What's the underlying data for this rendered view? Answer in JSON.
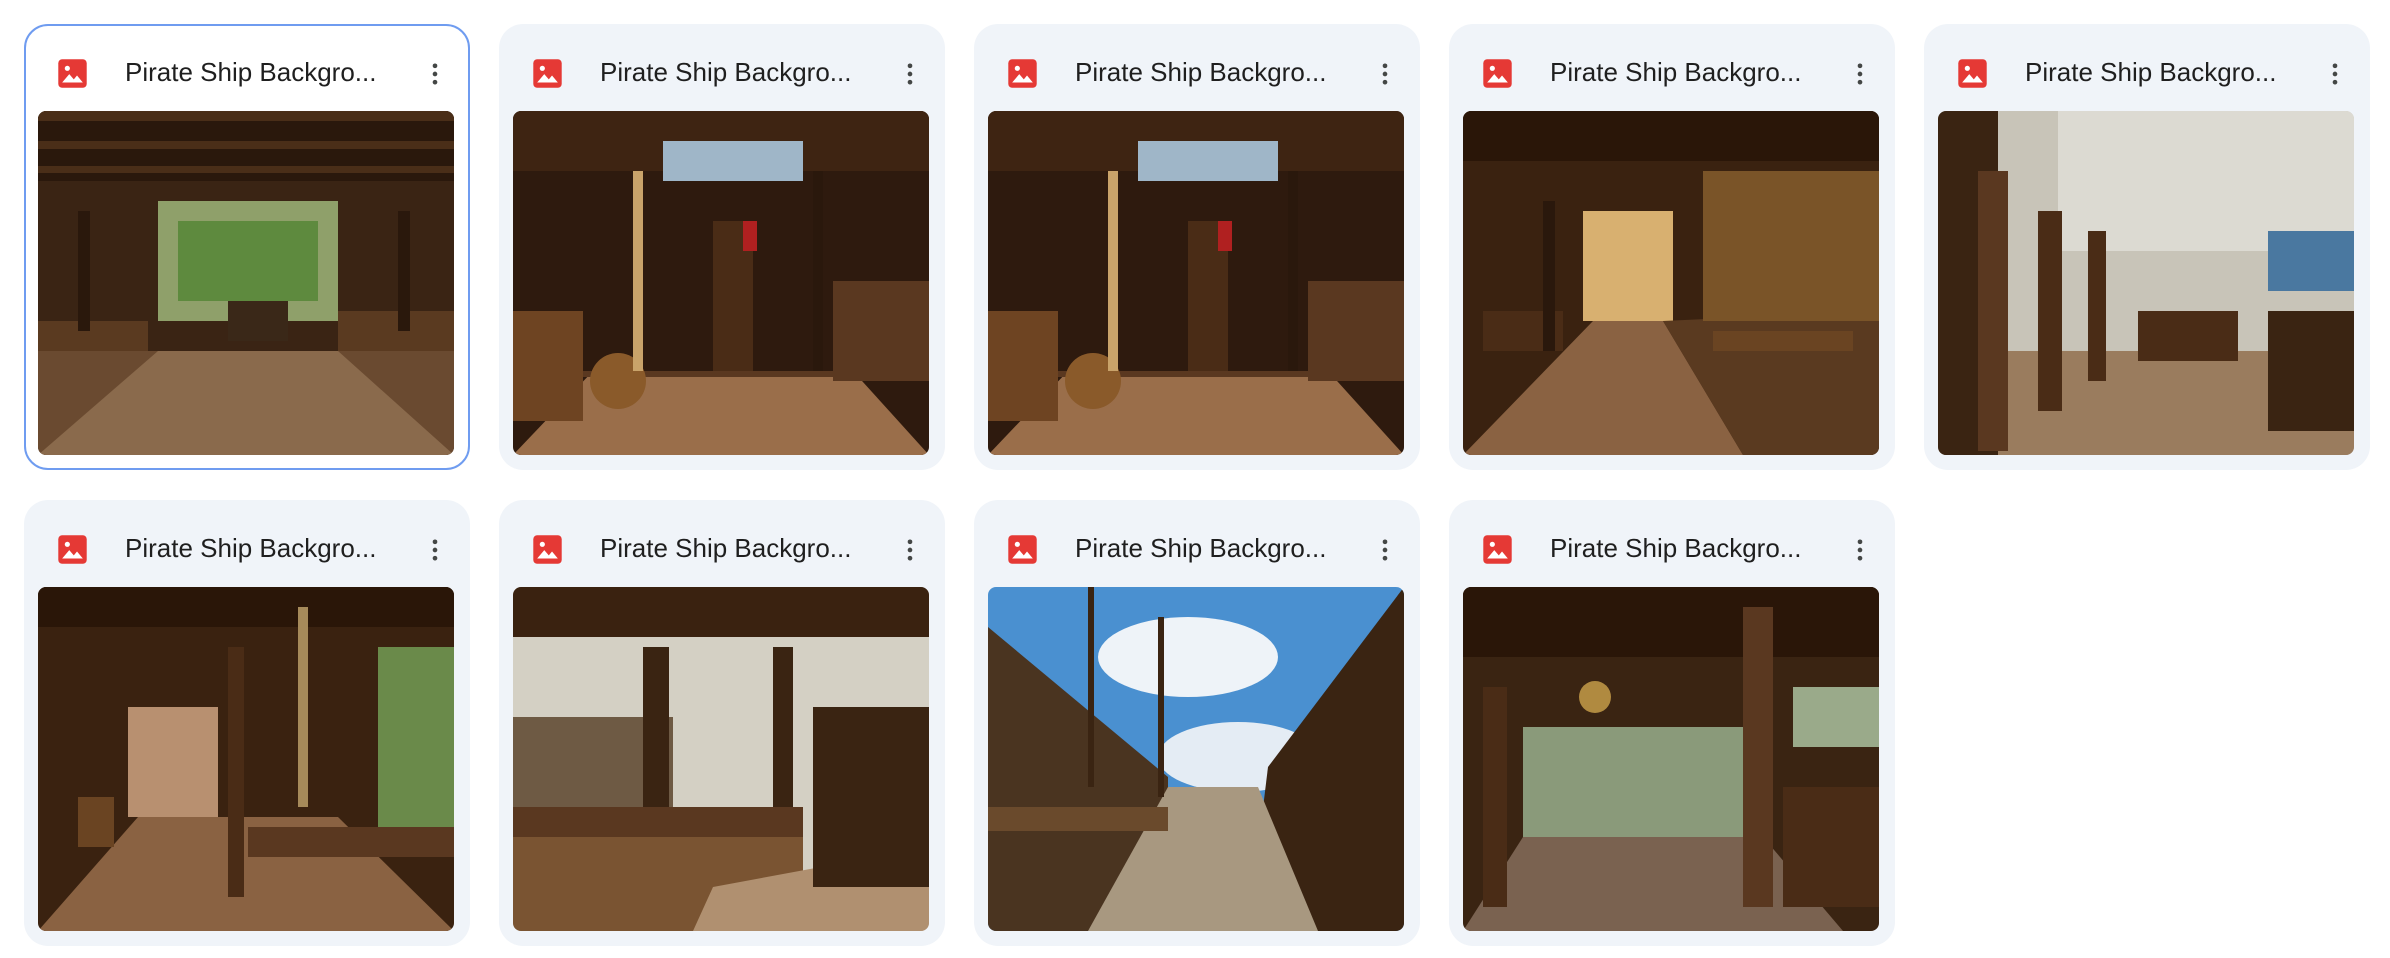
{
  "colors": {
    "card_background": "#f0f4f9",
    "selected_border": "#6f9cf0",
    "image_icon": "#e53935",
    "title_text": "#1f1f1f"
  },
  "icons": {
    "file_type": "image-file-icon",
    "menu": "more-vert-icon"
  },
  "files": [
    {
      "title": "Pirate Ship Backgro...",
      "selected": true,
      "scene": "cabin-interior"
    },
    {
      "title": "Pirate Ship Backgro...",
      "selected": false,
      "scene": "helm-deck"
    },
    {
      "title": "Pirate Ship Backgro...",
      "selected": false,
      "scene": "helm-deck"
    },
    {
      "title": "Pirate Ship Backgro...",
      "selected": false,
      "scene": "rope-gallery"
    },
    {
      "title": "Pirate Ship Backgro...",
      "selected": false,
      "scene": "open-deck-pillars"
    },
    {
      "title": "Pirate Ship Backgro...",
      "selected": false,
      "scene": "covered-walkway"
    },
    {
      "title": "Pirate Ship Backgro...",
      "selected": false,
      "scene": "railing-deck"
    },
    {
      "title": "Pirate Ship Backgro...",
      "selected": false,
      "scene": "main-deck-sky"
    },
    {
      "title": "Pirate Ship Backgro...",
      "selected": false,
      "scene": "clock-deck"
    }
  ]
}
